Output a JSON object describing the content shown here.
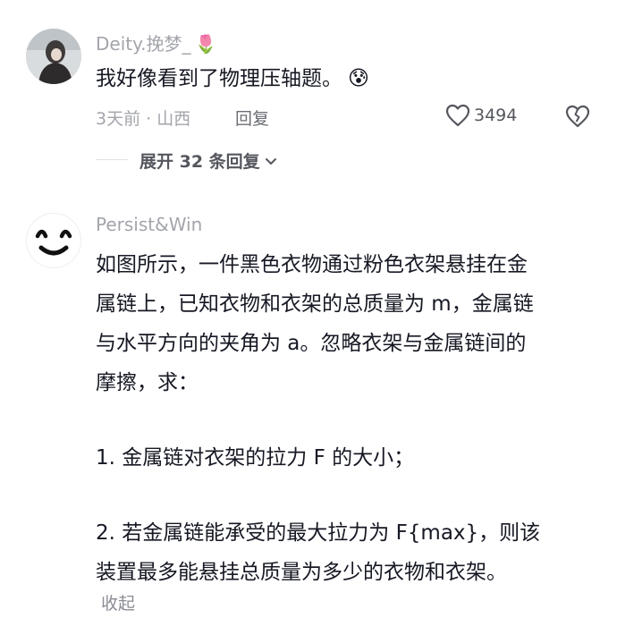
{
  "comment1": {
    "username": "Deity.挽梦_",
    "username_emoji": "🌷",
    "text": "我好像看到了物理压轴题。",
    "text_emoji": "😰",
    "meta": "3天前 · 山西",
    "reply_label": "回复",
    "like_count": "3494",
    "expand_label": "展开 32 条回复"
  },
  "comment2": {
    "username": "Persist&Win",
    "lines": [
      "如图所示，一件黑色衣物通过粉色衣架悬挂在金",
      "属链上，已知衣物和衣架的总质量为 m，金属链",
      "与水平方向的夹角为 a。忽略衣架与金属链间的",
      "摩擦，求：",
      "",
      "1. 金属链对衣架的拉力 F 的大小；",
      "",
      "2. 若金属链能承受的最大拉力为 F{max}，则该",
      "装置最多能悬挂总质量为多少的衣物和衣架。"
    ],
    "collapse_label": "收起"
  },
  "colors": {
    "username": "#a3a5ab",
    "text": "#161823",
    "meta": "#a3a5ab",
    "icon": "#55575e"
  },
  "icons": [
    "heart-icon",
    "broken-heart-icon",
    "chevron-down-icon"
  ]
}
